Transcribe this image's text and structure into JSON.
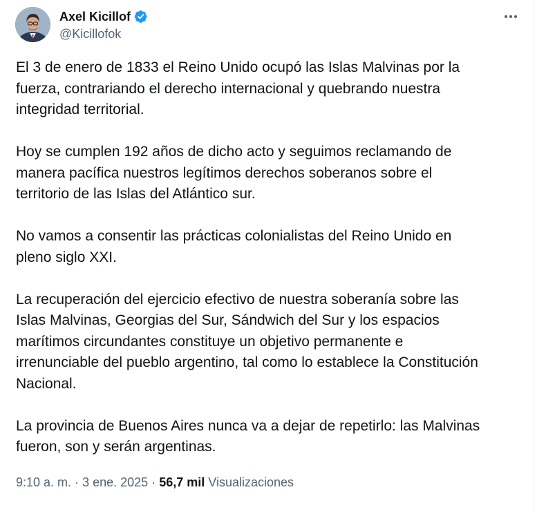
{
  "author": {
    "name": "Axel Kicillof",
    "handle": "@Kicillofok",
    "verified": true,
    "verified_color": "#1d9bf0"
  },
  "tweet": {
    "paragraphs": [
      "El 3 de enero de 1833 el Reino Unido ocupó las Islas Malvinas por la\nfuerza, contrariando el derecho internacional y quebrando nuestra\nintegridad territorial.",
      "Hoy se cumplen 192 años de dicho acto y seguimos reclamando de\nmanera pacífica nuestros legítimos derechos soberanos sobre el\nterritorio de las Islas del Atlántico sur.",
      "No vamos a consentir las prácticas colonialistas del Reino Unido en\npleno siglo XXI.",
      "La recuperación del ejercicio efectivo de nuestra soberanía sobre las\nIslas Malvinas, Georgias del Sur, Sándwich del Sur y los espacios\nmarítimos circundantes constituye un objetivo permanente e\nirrenunciable del pueblo argentino, tal como lo establece la Constitución\nNacional.",
      "La provincia de Buenos Aires nunca va a dejar de repetirlo: las Malvinas\nfueron, son y serán argentinas."
    ]
  },
  "meta": {
    "time": "9:10 a. m.",
    "separator": "·",
    "date": "3 ene. 2025",
    "views_count": "56,7 mil",
    "views_label": "Visualizaciones"
  },
  "icons": {
    "avatar": "avatar-photo",
    "verified": "verified-badge-icon",
    "more": "more-options-icon"
  }
}
